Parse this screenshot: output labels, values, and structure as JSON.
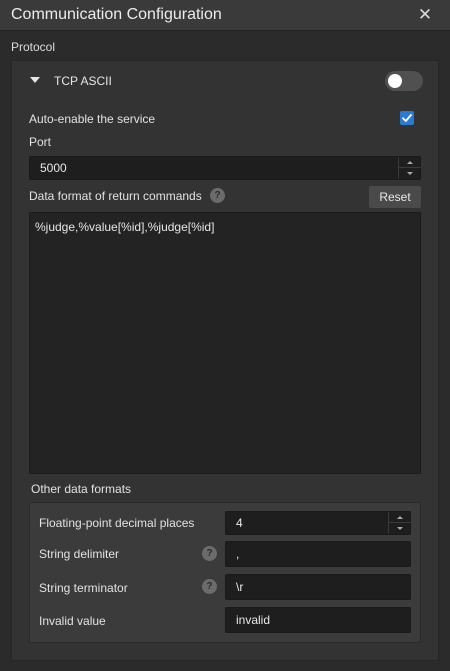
{
  "window": {
    "title": "Communication Configuration",
    "close_symbol": "✕"
  },
  "section": {
    "label": "Protocol"
  },
  "tcp": {
    "title": "TCP ASCII",
    "enabled": false,
    "auto_enable_label": "Auto-enable the service",
    "auto_enable_checked": true,
    "port_label": "Port",
    "port_value": "5000",
    "format_label": "Data format of return commands",
    "reset_label": "Reset",
    "format_value": "%judge,%value[%id],%judge[%id]"
  },
  "other_formats": {
    "heading": "Other data formats",
    "decimal_label": "Floating-point decimal places",
    "decimal_value": "4",
    "delimiter_label": "String delimiter",
    "delimiter_value": ",",
    "terminator_label": "String terminator",
    "terminator_value": "\\r",
    "invalid_label": "Invalid value",
    "invalid_value": "invalid"
  },
  "icons": {
    "help_glyph": "?",
    "accent": "#2a7bd6"
  }
}
